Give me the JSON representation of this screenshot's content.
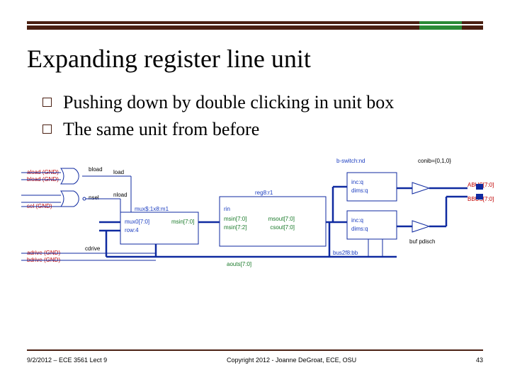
{
  "header": {
    "title": "Expanding register line unit"
  },
  "bullets": [
    "Pushing down by double clicking in unit box",
    "The same unit from before"
  ],
  "diagram": {
    "top_label": "b-switch:nd",
    "right_top_label": "conib={0,1,0}",
    "inputs": [
      {
        "name": "aload (GND)",
        "sig": "bload"
      },
      {
        "name": "bload (GND)",
        "sig": ""
      },
      {
        "name": "nsel",
        "sig": ""
      },
      {
        "name": "sel (GND)",
        "sig": ""
      },
      {
        "name": "adrive (GND)",
        "sig": "cdrive"
      },
      {
        "name": "bdrive (GND)",
        "sig": ""
      }
    ],
    "gate_out": {
      "top": "load",
      "bot": "nload"
    },
    "mux": {
      "label": "mux$:1x8:m1",
      "a": "mux0[7:0]",
      "b": "row:4"
    },
    "reg": {
      "label": "reg8:r1",
      "in": "msin[7:0]",
      "in2": "msin[7:2]",
      "out": "msout[7:0]",
      "out2": "csout[7:0]"
    },
    "right_inner": {
      "a": "inc:q",
      "b": "dims:q",
      "c": "inc:q",
      "d": "dims:q"
    },
    "right_out": {
      "bus_a": "ABUS[7:0]",
      "bus_b": "BBUS[7:0]",
      "drv": "buf pdisch"
    },
    "bottom": {
      "a": "aouts[7:0]",
      "line": "bus2f8:bb"
    }
  },
  "footer": {
    "left": "9/2/2012 – ECE 3561 Lect 9",
    "center": "Copyright 2012 - Joanne DeGroat, ECE, OSU",
    "right": "43"
  }
}
